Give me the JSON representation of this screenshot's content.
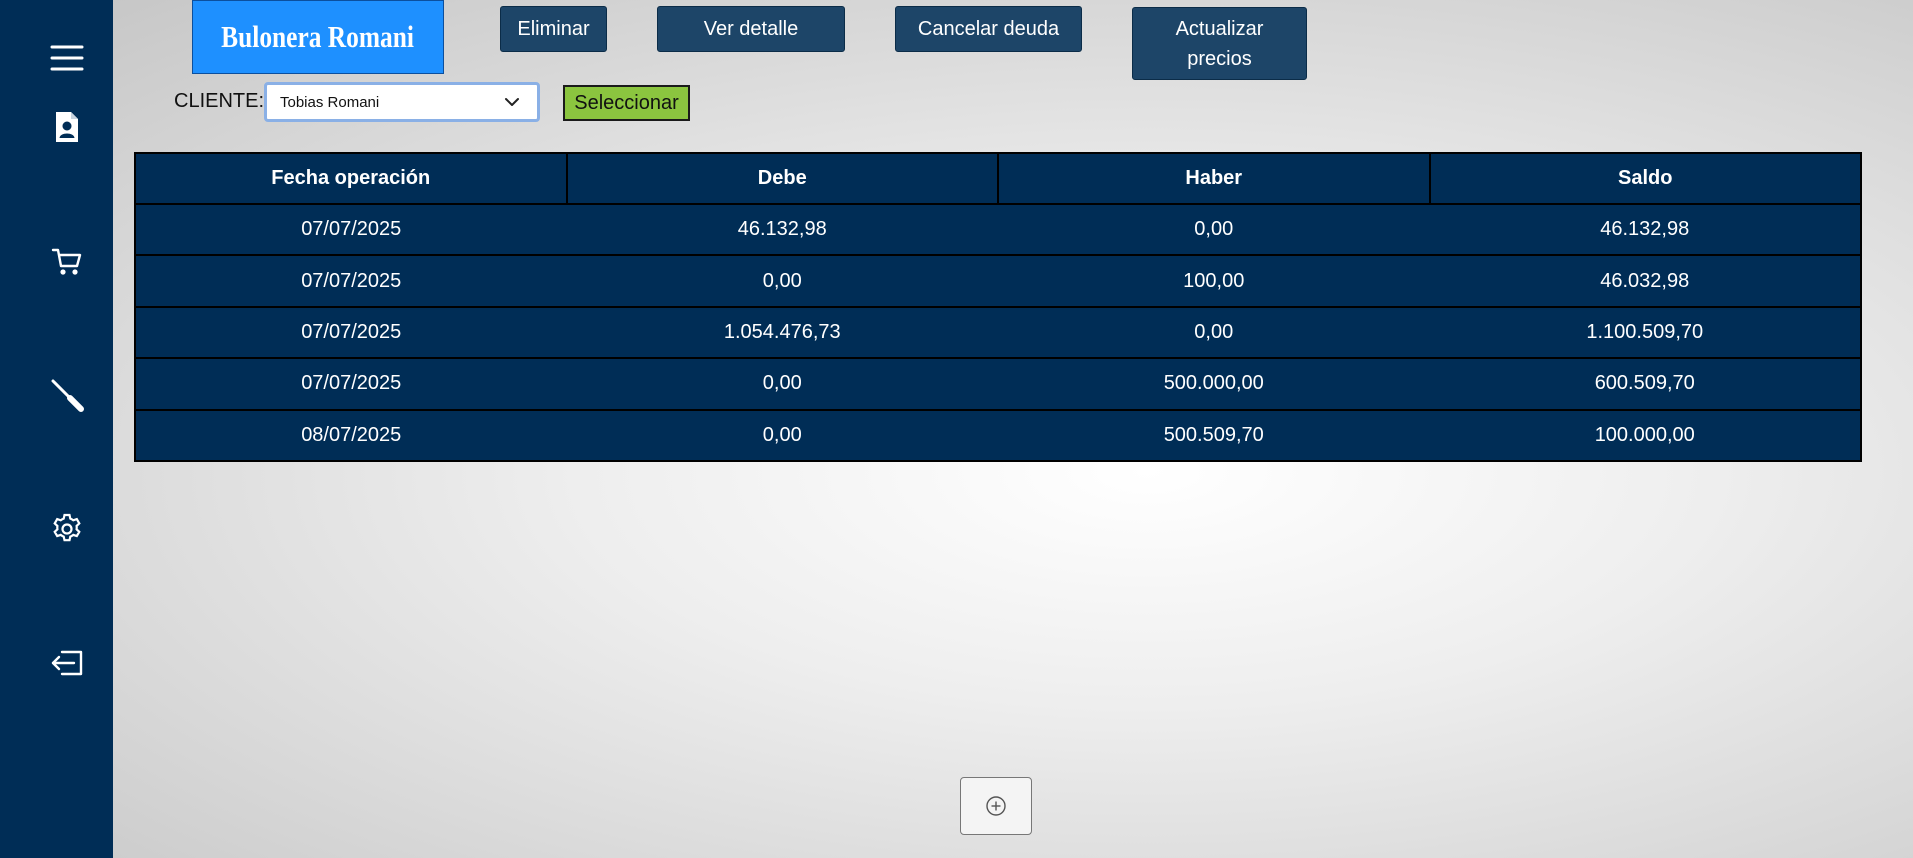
{
  "brand": {
    "name": "Bulonera Romani",
    "color": "#1e90ff"
  },
  "sidebar": {
    "color": "#002d56",
    "items": [
      {
        "icon": "menu-icon"
      },
      {
        "icon": "client-document-icon"
      },
      {
        "icon": "cart-icon"
      },
      {
        "icon": "screwdriver-icon"
      },
      {
        "icon": "gear-icon"
      },
      {
        "icon": "logout-icon"
      }
    ]
  },
  "toolbar": {
    "eliminar": "Eliminar",
    "ver_detalle": "Ver detalle",
    "cancelar_deuda": "Cancelar deuda",
    "actualizar_precios_1": "Actualizar",
    "actualizar_precios_2": "precios"
  },
  "cliente": {
    "label": "CLIENTE:",
    "selected": "Tobias Romani",
    "select_button": "Seleccionar"
  },
  "table": {
    "headers": [
      "Fecha operación",
      "Debe",
      "Haber",
      "Saldo"
    ],
    "rows": [
      [
        "07/07/2025",
        "46.132,98",
        "0,00",
        "46.132,98"
      ],
      [
        "07/07/2025",
        "0,00",
        "100,00",
        "46.032,98"
      ],
      [
        "07/07/2025",
        "1.054.476,73",
        "0,00",
        "1.100.509,70"
      ],
      [
        "07/07/2025",
        "0,00",
        "500.000,00",
        "600.509,70"
      ],
      [
        "08/07/2025",
        "0,00",
        "500.509,70",
        "100.000,00"
      ]
    ]
  },
  "add_button": {
    "icon": "plus-circle-icon"
  }
}
